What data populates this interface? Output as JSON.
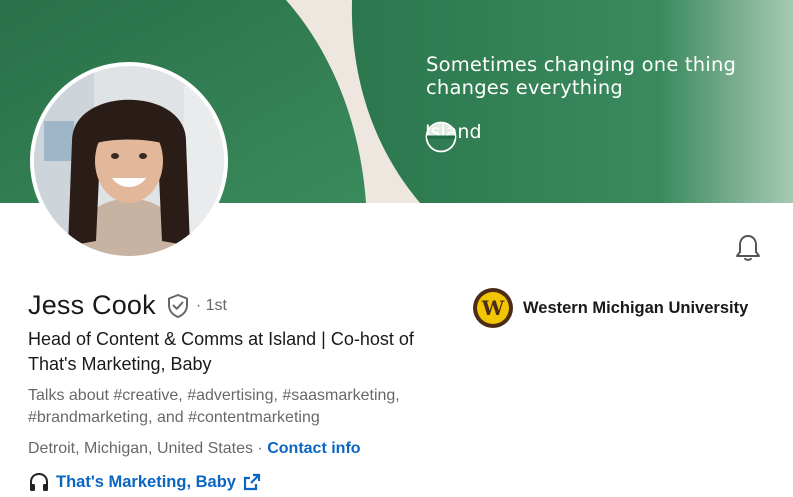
{
  "banner": {
    "tagline": "Sometimes changing one thing changes everything",
    "brand_name": "Island",
    "bg_color": "#2f7a4f",
    "accent_color": "#eee7df"
  },
  "profile": {
    "name": "Jess Cook",
    "degree": "· 1st",
    "headline": "Head of Content & Comms at Island | Co-host of That's Marketing, Baby",
    "talks_about": "Talks about #creative, #advertising, #saasmarketing, #brandmarketing, and #contentmarketing",
    "location": "Detroit, Michigan, United States",
    "location_separator": " · ",
    "contact_label": "Contact info",
    "featured_link": "That's Marketing, Baby"
  },
  "education": {
    "name": "Western Michigan University",
    "logo_letter": "W"
  },
  "icons": {
    "bell": "bell-icon",
    "verified": "shield-check-icon",
    "headphones": "headphones-icon",
    "external": "external-link-icon"
  },
  "colors": {
    "link": "#0a66c2",
    "wmu_brown": "#4a2c17",
    "wmu_gold": "#f1c500"
  }
}
